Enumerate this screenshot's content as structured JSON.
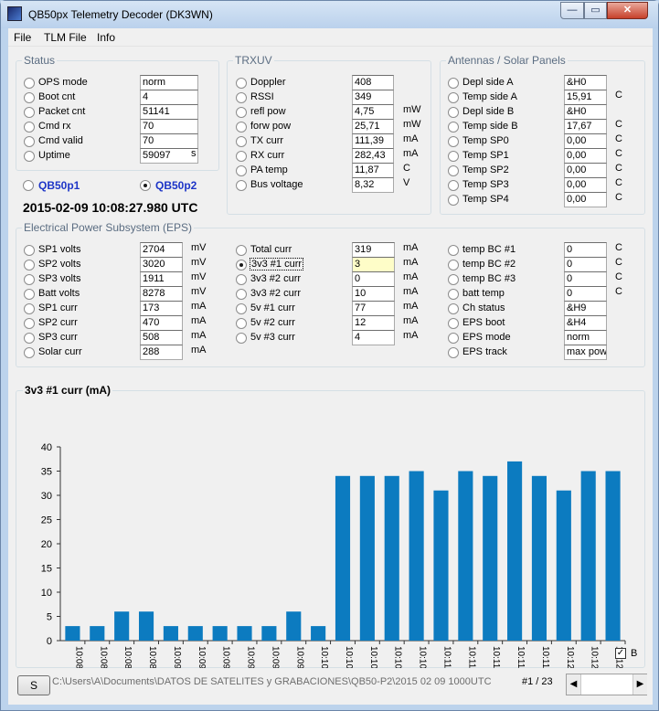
{
  "window": {
    "title": "QB50px Telemetry Decoder (DK3WN)",
    "min": "—",
    "max": "▭",
    "close": "✕"
  },
  "menu": [
    "File",
    "TLM File",
    "Info"
  ],
  "status": {
    "title": "Status",
    "rows": [
      {
        "label": "OPS mode",
        "value": "norm",
        "unit": ""
      },
      {
        "label": "Boot cnt",
        "value": "4",
        "unit": ""
      },
      {
        "label": "Packet cnt",
        "value": "51141",
        "unit": ""
      },
      {
        "label": "Cmd rx",
        "value": "70",
        "unit": ""
      },
      {
        "label": "Cmd valid",
        "value": "70",
        "unit": ""
      },
      {
        "label": "Uptime",
        "value": "59097",
        "unit": "s"
      }
    ]
  },
  "satellites": [
    {
      "label": "QB50p1",
      "selected": false
    },
    {
      "label": "QB50p2",
      "selected": true
    }
  ],
  "timestamp": "2015-02-09 10:08:27.980 UTC",
  "trxuv": {
    "title": "TRXUV",
    "rows": [
      {
        "label": "Doppler",
        "value": "408",
        "unit": ""
      },
      {
        "label": "RSSI",
        "value": "349",
        "unit": ""
      },
      {
        "label": "refl pow",
        "value": "4,75",
        "unit": "mW"
      },
      {
        "label": "forw pow",
        "value": "25,71",
        "unit": "mW"
      },
      {
        "label": "TX curr",
        "value": "111,39",
        "unit": "mA"
      },
      {
        "label": "RX curr",
        "value": "282,43",
        "unit": "mA"
      },
      {
        "label": "PA temp",
        "value": "11,87",
        "unit": "C"
      },
      {
        "label": "Bus voltage",
        "value": "8,32",
        "unit": "V"
      }
    ]
  },
  "antennas": {
    "title": "Antennas / Solar Panels",
    "rows": [
      {
        "label": "Depl side A",
        "value": "&H0",
        "unit": ""
      },
      {
        "label": "Temp side A",
        "value": "15,91",
        "unit": "C"
      },
      {
        "label": "Depl side B",
        "value": "&H0",
        "unit": ""
      },
      {
        "label": "Temp side B",
        "value": "17,67",
        "unit": "C"
      },
      {
        "label": "Temp SP0",
        "value": "0,00",
        "unit": "C"
      },
      {
        "label": "Temp SP1",
        "value": "0,00",
        "unit": "C"
      },
      {
        "label": "Temp SP2",
        "value": "0,00",
        "unit": "C"
      },
      {
        "label": "Temp SP3",
        "value": "0,00",
        "unit": "C"
      },
      {
        "label": "Temp SP4",
        "value": "0,00",
        "unit": "C"
      }
    ]
  },
  "eps": {
    "title": "Electrical Power Subsystem (EPS)",
    "col1": [
      {
        "label": "SP1 volts",
        "value": "2704",
        "unit": "mV"
      },
      {
        "label": "SP2 volts",
        "value": "3020",
        "unit": "mV"
      },
      {
        "label": "SP3 volts",
        "value": "1911",
        "unit": "mV"
      },
      {
        "label": "Batt volts",
        "value": "8278",
        "unit": "mV"
      },
      {
        "label": "SP1 curr",
        "value": "173",
        "unit": "mA"
      },
      {
        "label": "SP2 curr",
        "value": "470",
        "unit": "mA"
      },
      {
        "label": "SP3 curr",
        "value": "508",
        "unit": "mA"
      },
      {
        "label": "Solar curr",
        "value": "288",
        "unit": "mA"
      }
    ],
    "col2": [
      {
        "label": "Total curr",
        "value": "319",
        "unit": "mA"
      },
      {
        "label": "3v3 #1 curr",
        "value": "3",
        "unit": "mA",
        "selected": true
      },
      {
        "label": "3v3 #2 curr",
        "value": "0",
        "unit": "mA"
      },
      {
        "label": "3v3 #2 curr",
        "value": "10",
        "unit": "mA"
      },
      {
        "label": "5v #1 curr",
        "value": "77",
        "unit": "mA"
      },
      {
        "label": "5v #2 curr",
        "value": "12",
        "unit": "mA"
      },
      {
        "label": "5v #3 curr",
        "value": "4",
        "unit": "mA"
      }
    ],
    "col3": [
      {
        "label": "temp BC #1",
        "value": "0",
        "unit": "C"
      },
      {
        "label": "temp BC #2",
        "value": "0",
        "unit": "C"
      },
      {
        "label": "temp BC #3",
        "value": "0",
        "unit": "C"
      },
      {
        "label": "batt temp",
        "value": "0",
        "unit": "C"
      },
      {
        "label": "Ch status",
        "value": "&H9",
        "unit": ""
      },
      {
        "label": "EPS boot",
        "value": "&H4",
        "unit": ""
      },
      {
        "label": "EPS mode",
        "value": "norm",
        "unit": ""
      },
      {
        "label": "EPS track",
        "value": "max pow",
        "unit": ""
      }
    ]
  },
  "chart_data": {
    "type": "bar",
    "title": "3v3 #1 curr (mA)",
    "categories": [
      "10:08",
      "10:08",
      "10:08",
      "10:08",
      "10:09",
      "10:09",
      "10:09",
      "10:09",
      "10:09",
      "10:09",
      "10:10",
      "10:10",
      "10:10",
      "10:10",
      "10:10",
      "10:11",
      "10:11",
      "10:11",
      "10:11",
      "10:11",
      "10:12",
      "10:12",
      "10:12"
    ],
    "values": [
      3,
      3,
      6,
      6,
      3,
      3,
      3,
      3,
      3,
      6,
      3,
      34,
      34,
      34,
      35,
      31,
      35,
      34,
      37,
      34,
      31,
      35,
      35
    ],
    "ylim": [
      0,
      40
    ],
    "yticks": [
      0,
      5,
      10,
      15,
      20,
      25,
      30,
      35,
      40
    ],
    "grid": false,
    "bar_color": "#0c7bc0"
  },
  "chart_checkbox": {
    "label": "B",
    "checked": true
  },
  "footer": {
    "s_button": "S",
    "path": "C:\\Users\\A\\Documents\\DATOS DE SATELITES y GRABACIONES\\QB50-P2\\2015 02 09 1000UTC\\",
    "pager": "#1 / 23",
    "prev": "◀",
    "next": "▶"
  }
}
